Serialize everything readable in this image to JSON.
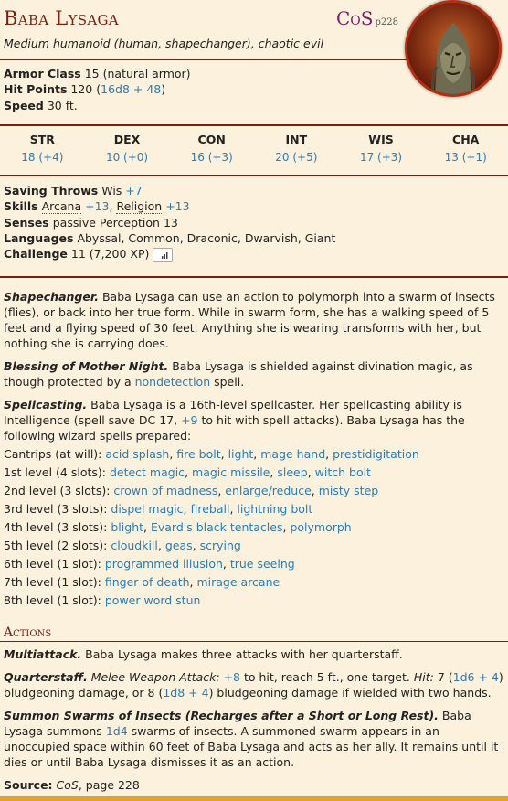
{
  "header": {
    "name": "Baba Lysaga",
    "source_abbr": "CoS",
    "source_page": "p228",
    "subtitle": "Medium humanoid (human, shapechanger), chaotic evil"
  },
  "portrait_icon": "hag-portrait",
  "stats": {
    "ac_label": "Armor Class",
    "ac_value": "15 (natural armor)",
    "hp_label": "Hit Points",
    "hp_value": "120",
    "hp_formula": "16d8 + 48",
    "speed_label": "Speed",
    "speed_value": "30 ft."
  },
  "abilities": [
    {
      "name": "STR",
      "score": "18 (+4)"
    },
    {
      "name": "DEX",
      "score": "10 (+0)"
    },
    {
      "name": "CON",
      "score": "16 (+3)"
    },
    {
      "name": "INT",
      "score": "20 (+5)"
    },
    {
      "name": "WIS",
      "score": "17 (+3)"
    },
    {
      "name": "CHA",
      "score": "13 (+1)"
    }
  ],
  "traits": {
    "saves_label": "Saving Throws",
    "saves_stat": "Wis",
    "saves_bonus": "+7",
    "skills_label": "Skills",
    "skill1": "Arcana",
    "skill1_bonus": "+13",
    "skill2": "Religion",
    "skill2_bonus": "+13",
    "senses_label": "Senses",
    "senses_value": "passive Perception 13",
    "languages_label": "Languages",
    "languages_value": "Abyssal, Common, Draconic, Dwarvish, Giant",
    "challenge_label": "Challenge",
    "challenge_value": "11 (7,200 XP)"
  },
  "features": {
    "shape_name": "Shapechanger.",
    "shape_text": "Baba Lysaga can use an action to polymorph into a swarm of insects (flies), or back into her true form. While in swarm form, she has a walking speed of 5 feet and a flying speed of 30 feet. Anything she is wearing transforms with her, but nothing she is carrying does.",
    "blessing_name": "Blessing of Mother Night.",
    "blessing_text": "Baba Lysaga is shielded against divination magic, as though protected by a",
    "blessing_link": "nondetection",
    "blessing_end": "spell.",
    "spell_name": "Spellcasting.",
    "spell_text1": "Baba Lysaga is a 16th-level spellcaster. Her spellcasting ability is Intelligence (spell save DC 17,",
    "spell_bonus": "+9",
    "spell_text2": "to hit with spell attacks). Baba Lysaga has the following wizard spells prepared:"
  },
  "spell_levels": [
    {
      "label": "Cantrips (at will):",
      "spells": [
        "acid splash",
        "fire bolt",
        "light",
        "mage hand",
        "prestidigitation"
      ]
    },
    {
      "label": "1st level (4 slots):",
      "spells": [
        "detect magic",
        "magic missile",
        "sleep",
        "witch bolt"
      ]
    },
    {
      "label": "2nd level (3 slots):",
      "spells": [
        "crown of madness",
        "enlarge/reduce",
        "misty step"
      ]
    },
    {
      "label": "3rd level (3 slots):",
      "spells": [
        "dispel magic",
        "fireball",
        "lightning bolt"
      ]
    },
    {
      "label": "4th level (3 slots):",
      "spells": [
        "blight",
        "Evard's black tentacles",
        "polymorph"
      ]
    },
    {
      "label": "5th level (2 slots):",
      "spells": [
        "cloudkill",
        "geas",
        "scrying"
      ]
    },
    {
      "label": "6th level (1 slot):",
      "spells": [
        "programmed illusion",
        "true seeing"
      ]
    },
    {
      "label": "7th level (1 slot):",
      "spells": [
        "finger of death",
        "mirage arcane"
      ]
    },
    {
      "label": "8th level (1 slot):",
      "spells": [
        "power word stun"
      ]
    }
  ],
  "actions": {
    "heading": "Actions",
    "multi_name": "Multiattack.",
    "multi_text": "Baba Lysaga makes three attacks with her quarterstaff.",
    "qs_name": "Quarterstaff.",
    "qs_type": "Melee Weapon Attack:",
    "qs_bonus": "+8",
    "qs_text1": "to hit, reach 5 ft., one target.",
    "qs_hit": "Hit:",
    "qs_text2": "7 (",
    "qs_dmg1": "1d6 + 4",
    "qs_text3": ") bludgeoning damage, or 8 (",
    "qs_dmg2": "1d8 + 4",
    "qs_text4": ") bludgeoning damage if wielded with two hands.",
    "sum_name": "Summon Swarms of Insects (Recharges after a Short or Long Rest).",
    "sum_text1": "Baba Lysaga summons",
    "sum_dice": "1d4",
    "sum_text2": "swarms of insects. A summoned swarm appears in an unoccupied space within 60 feet of Baba Lysaga and acts as her ally. It remains until it dies or until Baba Lysaga dismisses it as an action."
  },
  "footer": {
    "source_label": "Source:",
    "source_book": "CoS",
    "source_page": ", page 228"
  }
}
